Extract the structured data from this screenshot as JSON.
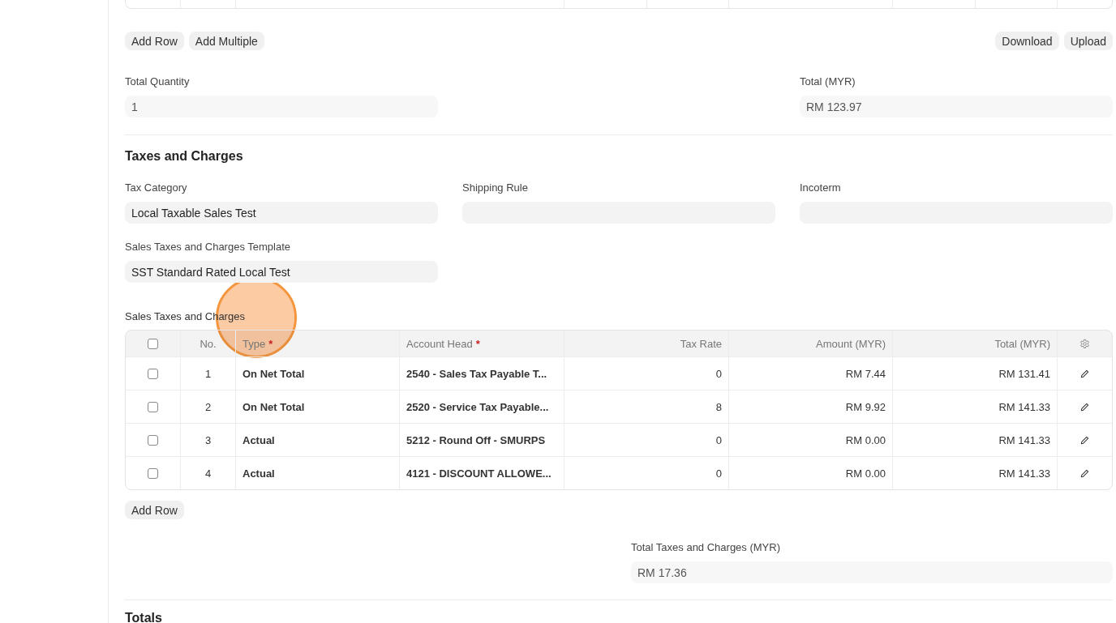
{
  "items_actions": {
    "left": [
      "Add Row",
      "Add Multiple"
    ],
    "right": [
      "Download",
      "Upload"
    ]
  },
  "items_totals": {
    "total_quantity": {
      "label": "Total Quantity",
      "value": "1"
    },
    "total": {
      "label": "Total (MYR)",
      "value": "RM 123.97"
    }
  },
  "taxes": {
    "title": "Taxes and Charges",
    "tax_category": {
      "label": "Tax Category",
      "value": "Local Taxable Sales Test"
    },
    "shipping_rule": {
      "label": "Shipping Rule"
    },
    "incoterm": {
      "label": "Incoterm"
    },
    "template": {
      "label": "Sales Taxes and Charges Template",
      "value": "SST Standard Rated Local Test"
    },
    "table": {
      "label": "Sales Taxes and Charges",
      "all_selected": false,
      "columns": [
        {
          "label": "No."
        },
        {
          "label": "Type",
          "required_mark": "*"
        },
        {
          "label": "Account Head",
          "required_mark": "*"
        },
        {
          "label": "Tax Rate"
        },
        {
          "label": "Amount (MYR)"
        },
        {
          "label": "Total (MYR)"
        }
      ],
      "rows": [
        {
          "selected": false,
          "no": "1",
          "type": "On Net Total",
          "account_head": "2540 - Sales Tax Payable T...",
          "tax_rate": "0",
          "amount": "RM 7.44",
          "total": "RM 131.41"
        },
        {
          "selected": false,
          "no": "2",
          "type": "On Net Total",
          "account_head": "2520 - Service Tax Payable...",
          "tax_rate": "8",
          "amount": "RM 9.92",
          "total": "RM 141.33"
        },
        {
          "selected": false,
          "no": "3",
          "type": "Actual",
          "account_head": "5212 - Round Off - SMURPS",
          "tax_rate": "0",
          "amount": "RM 0.00",
          "total": "RM 141.33"
        },
        {
          "selected": false,
          "no": "4",
          "type": "Actual",
          "account_head": "4121 - DISCOUNT ALLOWE...",
          "tax_rate": "0",
          "amount": "RM 0.00",
          "total": "RM 141.33"
        }
      ]
    },
    "add_row": "Add Row",
    "total_taxes": {
      "label": "Total Taxes and Charges (MYR)",
      "value": "RM 17.36"
    }
  },
  "totals": {
    "title": "Totals"
  }
}
